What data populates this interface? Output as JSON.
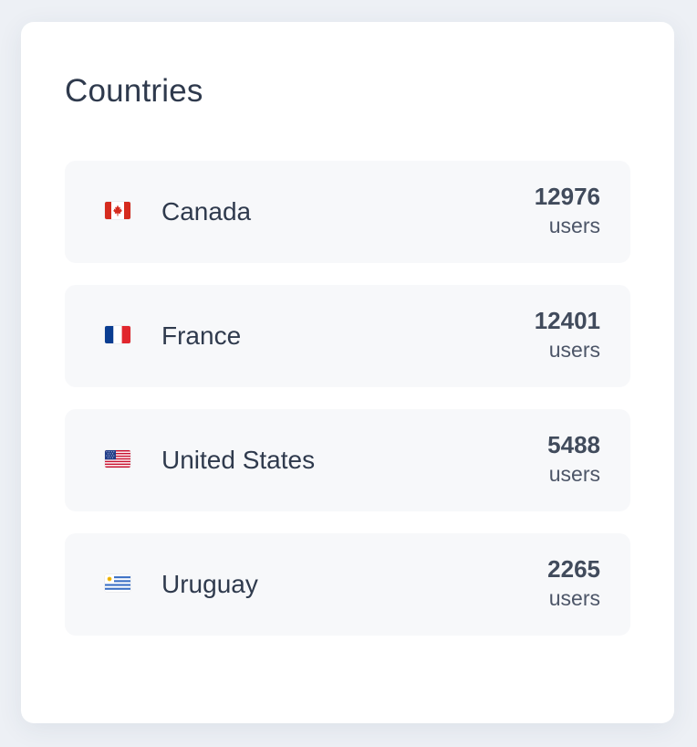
{
  "card": {
    "title": "Countries"
  },
  "countries": [
    {
      "name": "Canada",
      "users": "12976",
      "unit": "users",
      "flag": "canada-flag-icon"
    },
    {
      "name": "France",
      "users": "12401",
      "unit": "users",
      "flag": "france-flag-icon"
    },
    {
      "name": "United States",
      "users": "5488",
      "unit": "users",
      "flag": "united-states-flag-icon"
    },
    {
      "name": "Uruguay",
      "users": "2265",
      "unit": "users",
      "flag": "uruguay-flag-icon"
    }
  ],
  "colors": {
    "background": "#edf0f5",
    "card": "#ffffff",
    "row": "#f7f8fa",
    "text": "#2f3a4d"
  }
}
